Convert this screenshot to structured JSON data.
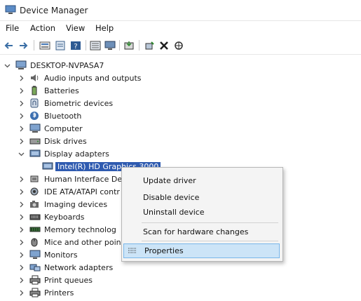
{
  "window": {
    "title": "Device Manager"
  },
  "menu": [
    "File",
    "Action",
    "View",
    "Help"
  ],
  "toolbar": [
    "back-icon",
    "forward-icon",
    "properties-icon",
    "show-hidden-icon",
    "help-icon",
    "view-icon",
    "monitor-icon",
    "update-driver-icon",
    "uninstall-icon",
    "scan-icon"
  ],
  "tree": {
    "root": "DESKTOP-NVPASA7",
    "categories": [
      "Audio inputs and outputs",
      "Batteries",
      "Biometric devices",
      "Bluetooth",
      "Computer",
      "Disk drives",
      "Display adapters",
      "Human Interface De",
      "IDE ATA/ATAPI contr",
      "Imaging devices",
      "Keyboards",
      "Memory technolog",
      "Mice and other poin",
      "Monitors",
      "Network adapters",
      "Print queues",
      "Printers"
    ],
    "expanded_child": "Intel(R) HD Graphics 3000"
  },
  "context_menu": {
    "items": [
      "Update driver",
      "Disable device",
      "Uninstall device",
      "Scan for hardware changes",
      "Properties"
    ],
    "highlighted": "Properties"
  },
  "colors": {
    "selection": "#2f5bb0",
    "menu_highlight": "#cce4f7",
    "menu_highlight_border": "#79b7ea"
  }
}
